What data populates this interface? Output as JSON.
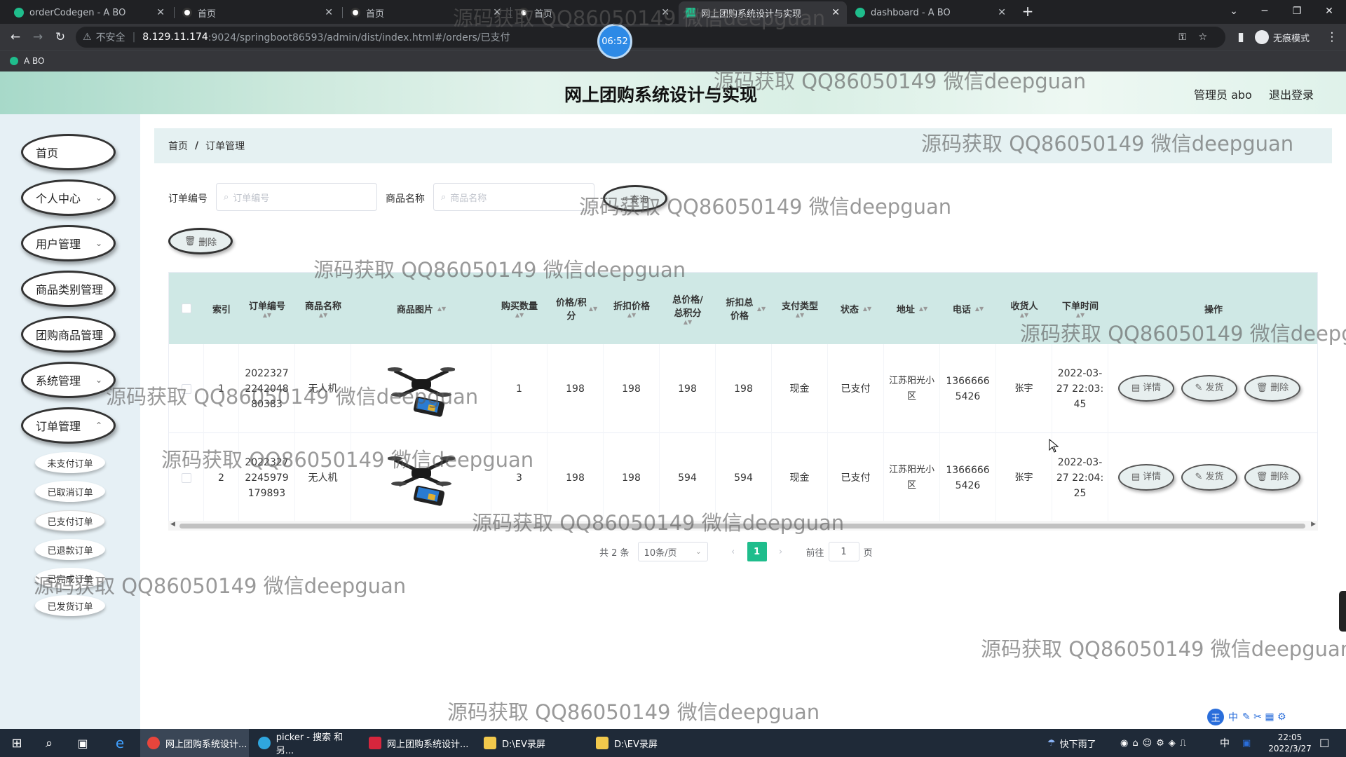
{
  "browser": {
    "tabs": [
      {
        "label": "orderCodegen - A BO",
        "active": false
      },
      {
        "label": "首页",
        "active": false
      },
      {
        "label": "首页",
        "active": false
      },
      {
        "label": "首页",
        "active": false
      },
      {
        "label": "网上团购系统设计与实现",
        "active": true
      },
      {
        "label": "dashboard - A BO",
        "active": false
      }
    ],
    "new_tab": "+",
    "security_label": "不安全",
    "url_host": "8.129.11.174",
    "url_path": ":9024/springboot86593/admin/dist/index.html#/orders/已支付",
    "profile": "无痕模式",
    "bookmark": "A BO",
    "recorder_time": "06:52"
  },
  "header": {
    "title": "网上团购系统设计与实现",
    "user": "管理员 abo",
    "logout": "退出登录"
  },
  "sidebar": {
    "menus": [
      {
        "label": "首页",
        "has_children": false
      },
      {
        "label": "个人中心",
        "has_children": true
      },
      {
        "label": "用户管理",
        "has_children": true
      },
      {
        "label": "商品类别管理",
        "has_children": false
      },
      {
        "label": "团购商品管理",
        "has_children": false
      },
      {
        "label": "系统管理",
        "has_children": true
      },
      {
        "label": "订单管理",
        "has_children": true
      }
    ],
    "submenus": [
      {
        "label": "未支付订单"
      },
      {
        "label": "已取消订单"
      },
      {
        "label": "已支付订单",
        "active": true
      },
      {
        "label": "已退款订单"
      },
      {
        "label": "已完成订单"
      },
      {
        "label": "已发货订单"
      }
    ]
  },
  "breadcrumb": {
    "home": "首页",
    "separator": "/",
    "current": "订单管理"
  },
  "filters": {
    "order_no_label": "订单编号",
    "order_no_placeholder": "订单编号",
    "product_label": "商品名称",
    "product_placeholder": "商品名称",
    "search_button": "查询",
    "delete_button": "删除"
  },
  "table": {
    "columns": [
      "索引",
      "订单编号",
      "商品名称",
      "商品图片",
      "购买数量",
      "价格/积分",
      "折扣价格",
      "总价格/总积分",
      "折扣总价格",
      "支付类型",
      "状态",
      "地址",
      "电话",
      "收货人",
      "下单时间",
      "操作"
    ],
    "rows": [
      {
        "index": "1",
        "order_no": "20223272242048 80383",
        "product": "无人机",
        "image": "drone",
        "qty": "1",
        "price": "198",
        "discount_price": "198",
        "total": "198",
        "discount_total": "198",
        "pay_type": "现金",
        "status": "已支付",
        "address": "江苏阳光小区",
        "phone": "13666665426",
        "receiver": "张宇",
        "time": "2022-03-27 22:03:45"
      },
      {
        "index": "2",
        "order_no": "20223272245979 179893",
        "product": "无人机",
        "image": "drone",
        "qty": "3",
        "price": "198",
        "discount_price": "198",
        "total": "594",
        "discount_total": "594",
        "pay_type": "现金",
        "status": "已支付",
        "address": "江苏阳光小区",
        "phone": "13666665426",
        "receiver": "张宇",
        "time": "2022-03-27 22:04:25"
      }
    ],
    "actions": [
      "详情",
      "发货",
      "删除"
    ]
  },
  "pagination": {
    "total": "共 2 条",
    "page_size": "10条/页",
    "current_page": "1",
    "goto_prefix": "前往",
    "goto_value": "1",
    "goto_suffix": "页"
  },
  "watermark": "源码获取 QQ86050149 微信deepguan",
  "taskbar": {
    "items": [
      "网上团购系统设计...",
      "picker - 搜索 和另...",
      "网上团购系统设计...",
      "D:\\EV录屏",
      "D:\\EV录屏"
    ],
    "weather": "快下雨了",
    "ime": "中",
    "time": "22:05",
    "date": "2022/3/27"
  },
  "colors": {
    "accent": "#1fbd8c",
    "header_cell": "#cfe8e5",
    "sidebar": "#e6f0f5",
    "breadcrumb": "#e5f1f2"
  }
}
